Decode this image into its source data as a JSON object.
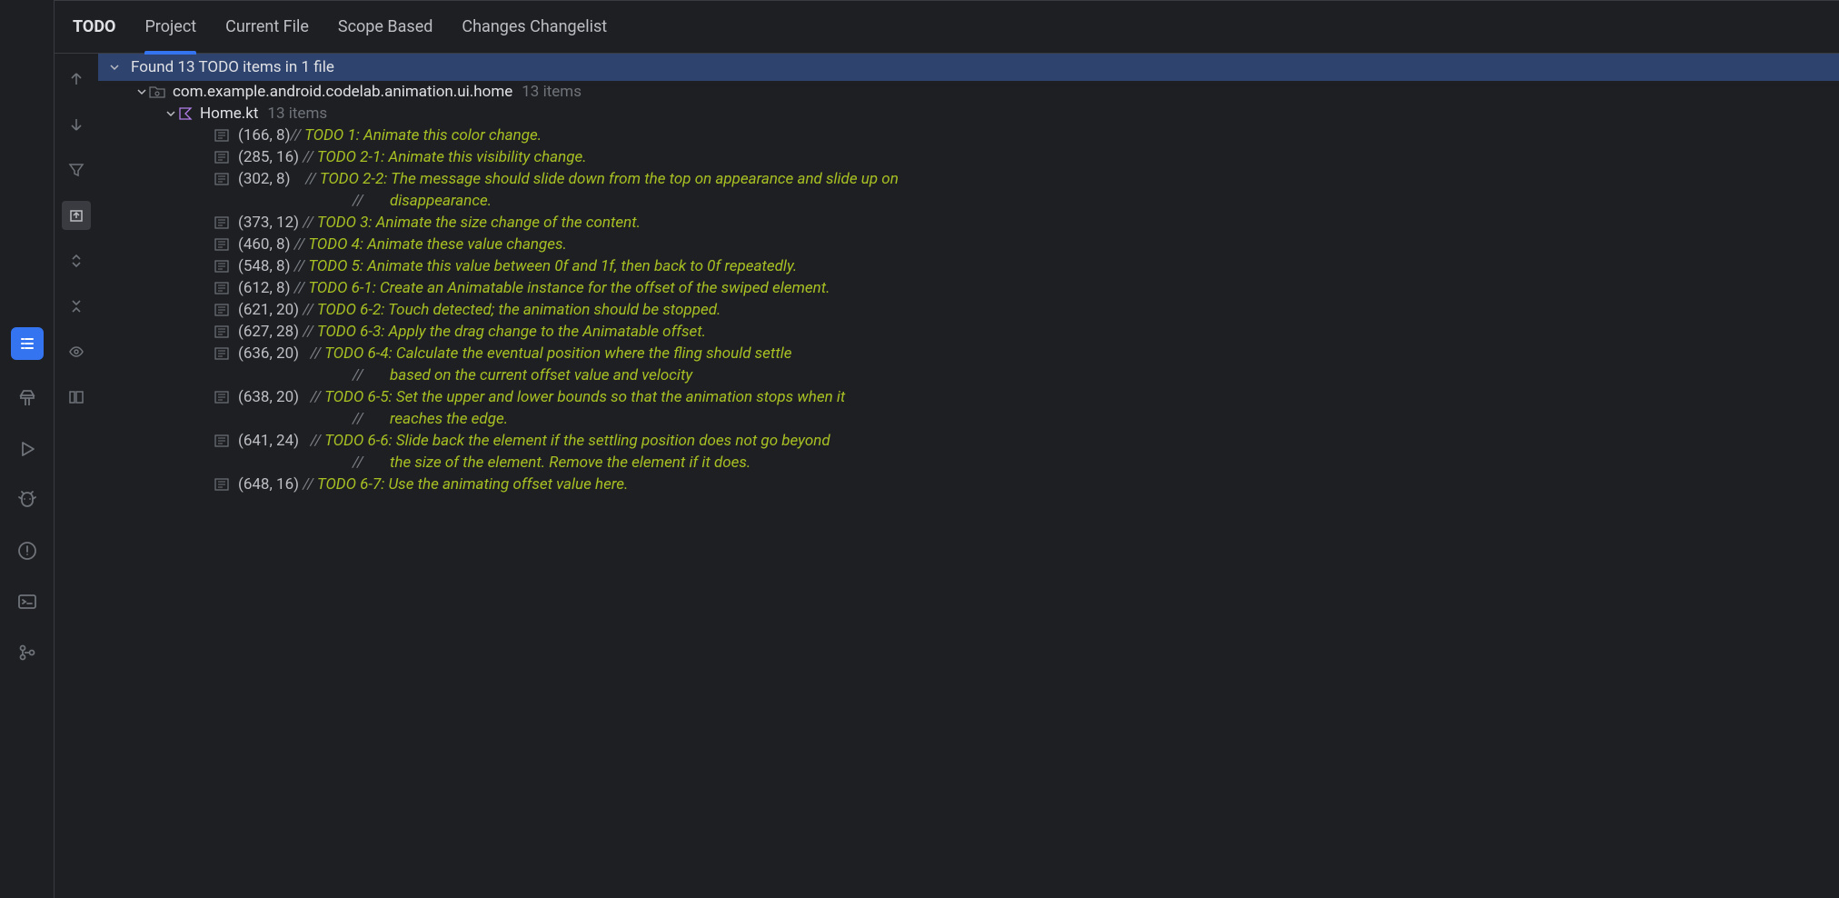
{
  "panel_title": "TODO",
  "tabs": [
    {
      "label": "Project",
      "active": true
    },
    {
      "label": "Current File",
      "active": false
    },
    {
      "label": "Scope Based",
      "active": false
    },
    {
      "label": "Changes Changelist",
      "active": false
    }
  ],
  "root_summary": "Found 13 TODO items in 1 file",
  "package_name": "com.example.android.codelab.animation.ui.home",
  "package_count": "13 items",
  "file_name": "Home.kt",
  "file_count": "13 items",
  "items": [
    {
      "loc": "(166, 8)",
      "prefix": "// ",
      "text": "TODO 1: Animate this color change."
    },
    {
      "loc": "(285, 16)",
      "prefix": " // ",
      "text": "TODO 2-1: Animate this visibility change."
    },
    {
      "loc": "(302, 8)",
      "prefix": "    // ",
      "text": "TODO 2-2: The message should slide down from the top on appearance and slide up on"
    },
    {
      "cont": true,
      "prefix": "//       ",
      "text": "disappearance."
    },
    {
      "loc": "(373, 12)",
      "prefix": " // ",
      "text": "TODO 3: Animate the size change of the content."
    },
    {
      "loc": "(460, 8)",
      "prefix": " // ",
      "text": "TODO 4: Animate these value changes."
    },
    {
      "loc": "(548, 8)",
      "prefix": " // ",
      "text": "TODO 5: Animate this value between 0f and 1f, then back to 0f repeatedly."
    },
    {
      "loc": "(612, 8)",
      "prefix": " // ",
      "text": "TODO 6-1: Create an Animatable instance for the offset of the swiped element."
    },
    {
      "loc": "(621, 20)",
      "prefix": " // ",
      "text": "TODO 6-2: Touch detected; the animation should be stopped."
    },
    {
      "loc": "(627, 28)",
      "prefix": " // ",
      "text": "TODO 6-3: Apply the drag change to the Animatable offset."
    },
    {
      "loc": "(636, 20)",
      "prefix": "   // ",
      "text": "TODO 6-4: Calculate the eventual position where the fling should settle"
    },
    {
      "cont": true,
      "prefix": "//       ",
      "text": "based on the current offset value and velocity"
    },
    {
      "loc": "(638, 20)",
      "prefix": "   // ",
      "text": "TODO 6-5: Set the upper and lower bounds so that the animation stops when it"
    },
    {
      "cont": true,
      "prefix": "//       ",
      "text": "reaches the edge."
    },
    {
      "loc": "(641, 24)",
      "prefix": "   // ",
      "text": "TODO 6-6: Slide back the element if the settling position does not go beyond"
    },
    {
      "cont": true,
      "prefix": "//       ",
      "text": "the size of the element. Remove the element if it does."
    },
    {
      "loc": "(648, 16)",
      "prefix": " // ",
      "text": "TODO 6-7: Use the animating offset value here."
    }
  ]
}
